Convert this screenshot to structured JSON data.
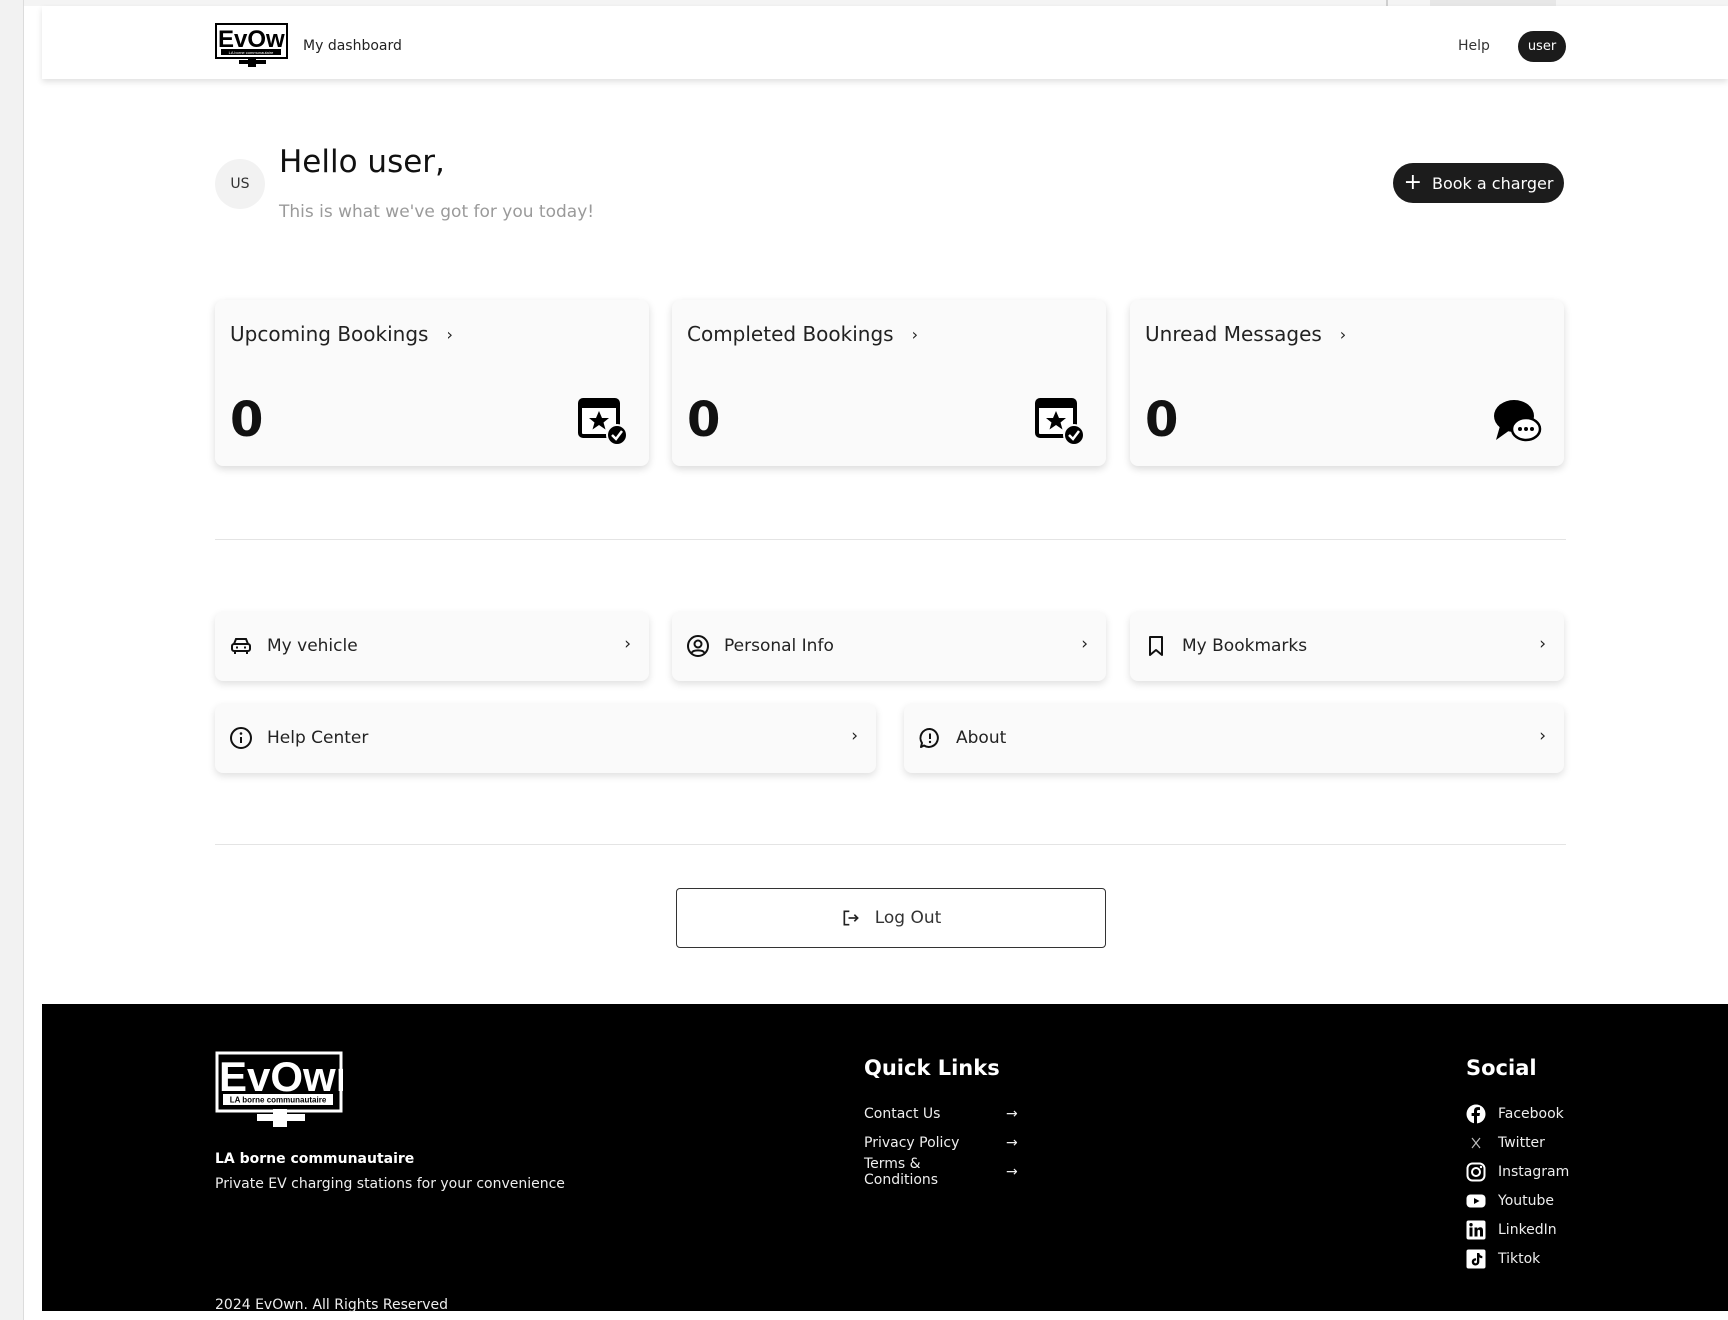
{
  "header": {
    "logo_text": "EvOwn",
    "logo_caption": "LA borne communautaire",
    "brand_link": "My dashboard",
    "help": "Help",
    "user": "user"
  },
  "greeting": {
    "avatar_initials": "US",
    "title": "Hello user,",
    "subtitle": "This is what we've got for you today!",
    "book_button": "Book a charger"
  },
  "stats": [
    {
      "label": "Upcoming Bookings",
      "value": "0",
      "icon": "calendar-star-check-icon"
    },
    {
      "label": "Completed Bookings",
      "value": "0",
      "icon": "calendar-star-check-icon"
    },
    {
      "label": "Unread Messages",
      "value": "0",
      "icon": "chat-bubble-icon"
    }
  ],
  "links": [
    {
      "label": "My vehicle",
      "icon": "car-icon"
    },
    {
      "label": "Personal Info",
      "icon": "user-circle-icon"
    },
    {
      "label": "My Bookmarks",
      "icon": "bookmark-icon"
    },
    {
      "label": "Help Center",
      "icon": "info-icon"
    },
    {
      "label": "About",
      "icon": "message-alert-icon"
    }
  ],
  "logout": "Log Out",
  "footer": {
    "company": "LA borne communautaire",
    "tagline": "Private EV charging stations for your convenience",
    "copyright": "2024 EvOwn. All Rights Reserved",
    "quick_links_title": "Quick Links",
    "quick_links": [
      "Contact Us",
      "Privacy Policy",
      "Terms & Conditions"
    ],
    "social_title": "Social",
    "social": [
      {
        "label": "Facebook",
        "icon": "facebook-icon"
      },
      {
        "label": "Twitter",
        "icon": "x-icon"
      },
      {
        "label": "Instagram",
        "icon": "instagram-icon"
      },
      {
        "label": "Youtube",
        "icon": "youtube-icon"
      },
      {
        "label": "LinkedIn",
        "icon": "linkedin-icon"
      },
      {
        "label": "Tiktok",
        "icon": "tiktok-icon"
      }
    ]
  }
}
